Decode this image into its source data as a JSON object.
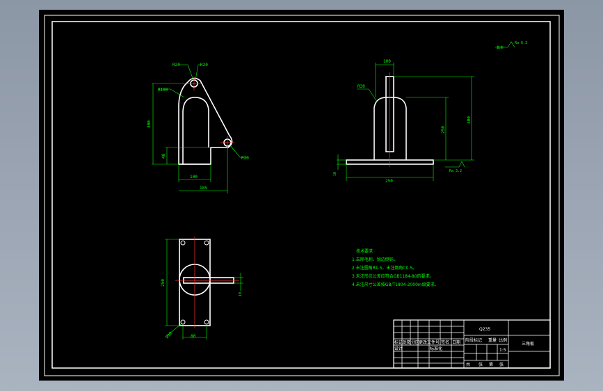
{
  "dimensions": {
    "front_view": {
      "r20_a": "R20",
      "r20_b": "R20",
      "r100": "R100",
      "h_300": "300",
      "h_40": "40",
      "w_100": "100",
      "w_185": "185",
      "r20_c": "R20"
    },
    "side_view": {
      "w_100": "100",
      "r30": "R30",
      "h_250": "250",
      "h_300": "300",
      "t_10": "10",
      "w_250": "250",
      "roughness": "Ra 3.2"
    },
    "top_view": {
      "h_250": "250",
      "w_80": "80",
      "r12": "R12",
      "t_10": "10"
    },
    "roughness_global": {
      "prefix": "其余",
      "value": "Ra 6.3"
    }
  },
  "notes": {
    "title": "技术要求",
    "items": [
      "1.去除毛刺、锐边倒钝。",
      "2.未注圆角R1.5，未注倒角C0.5。",
      "3.未注形位公差应符合GB1184-80的要求。",
      "4.未注尺寸公差按GB/T1804-2000m级要求。"
    ]
  },
  "title_block": {
    "material": "Q235",
    "part_name": "三角板",
    "small_labels": [
      "标记",
      "处数",
      "分区",
      "更改文件号",
      "签名",
      "日期"
    ],
    "stage_labels": [
      "阶段标记",
      "重量",
      "比例"
    ],
    "scale": "1:5",
    "sheet_labels": [
      "共",
      "张",
      "第",
      "张"
    ],
    "design_label": "设计",
    "standard_label": "标准化"
  }
}
